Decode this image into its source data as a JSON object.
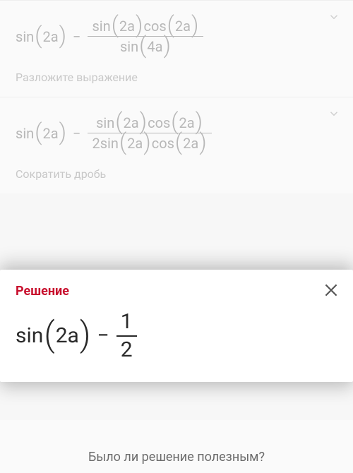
{
  "steps": [
    {
      "lhs": "sin",
      "lhs_arg": "2a",
      "op": "−",
      "num_a": "sin",
      "num_a_arg": "2a",
      "num_b": "cos",
      "num_b_arg": "2a",
      "den_a_coef": "",
      "den_a": "sin",
      "den_a_arg": "4a",
      "den_b": "",
      "den_b_arg": "",
      "label": "Разложите выражение"
    },
    {
      "lhs": "sin",
      "lhs_arg": "2a",
      "op": "−",
      "num_a": "sin",
      "num_a_arg": "2a",
      "num_b": "cos",
      "num_b_arg": "2a",
      "den_a_coef": "2",
      "den_a": "sin",
      "den_a_arg": "2a",
      "den_b": "cos",
      "den_b_arg": "2a",
      "label": "Сократить дробь"
    }
  ],
  "solution": {
    "title": "Решение",
    "lhs": "sin",
    "lhs_arg": "2a",
    "op": "−",
    "frac_num": "1",
    "frac_den": "2"
  },
  "helpful": "Было ли решение полезным?"
}
